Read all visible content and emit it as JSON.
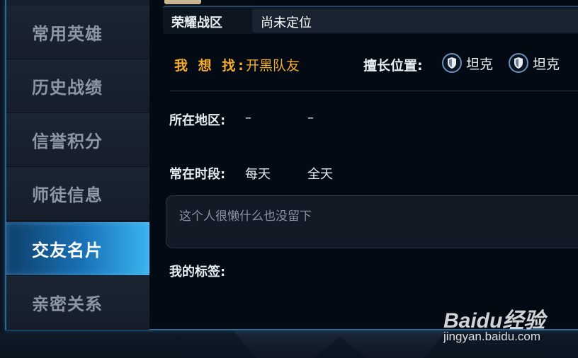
{
  "sidebar": {
    "items": [
      {
        "label": "常用英雄",
        "active": false
      },
      {
        "label": "历史战绩",
        "active": false
      },
      {
        "label": "信誉积分",
        "active": false
      },
      {
        "label": "师徒信息",
        "active": false
      },
      {
        "label": "交友名片",
        "active": true
      },
      {
        "label": "亲密关系",
        "active": false
      }
    ]
  },
  "server": {
    "label": "荣耀战区",
    "value": "尚未定位"
  },
  "seek": {
    "label": "我 想 找:",
    "value": "开黑队友"
  },
  "positions": {
    "label": "擅长位置:",
    "items": [
      {
        "icon": "shield-icon",
        "label": "坦克"
      },
      {
        "icon": "shield-icon",
        "label": "坦克"
      }
    ]
  },
  "region": {
    "label": "所在地区:",
    "value1": "–",
    "value2": "–"
  },
  "time": {
    "label": "常在时段:",
    "value1": "每天",
    "value2": "全天"
  },
  "bio": {
    "placeholder": "这个人很懒什么也没留下"
  },
  "tags": {
    "label": "我的标签:"
  },
  "watermark": {
    "brand": "Baidu经验",
    "url": "jingyan.baidu.com"
  },
  "colors": {
    "accent_gold": "#f2ad2c",
    "active_tab": "#1a74b8",
    "frame": "#2c6c9a"
  }
}
